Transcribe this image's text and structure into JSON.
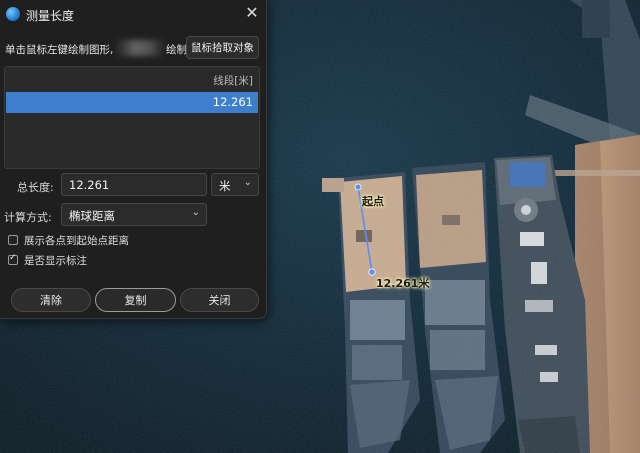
{
  "dialog": {
    "title": "测量长度",
    "instruction": "单击鼠标左键绘制图形,",
    "instruction_tail": "绘制",
    "pick_button": "鼠标拾取对象",
    "list": {
      "header": "线段[米]",
      "rows": [
        "12.261"
      ]
    },
    "total_length": {
      "label": "总长度:",
      "value": "12.261",
      "unit": "米"
    },
    "calc_method": {
      "label": "计算方式:",
      "value": "椭球距离"
    },
    "options": [
      {
        "label": "展示各点到起始点距离",
        "checked": false
      },
      {
        "label": "是否显示标注",
        "checked": true
      }
    ],
    "buttons": {
      "clear": "清除",
      "copy": "复制",
      "close": "关闭"
    }
  },
  "map_overlay": {
    "start_label": "起点",
    "measure_label": "12.261米"
  },
  "colors": {
    "accent": "#3d7fcc",
    "measure_line": "#5b8ff0",
    "dialog_bg": "#1f1f1f"
  },
  "icons": [
    "app-globe-icon",
    "close-icon",
    "chevron-down-icon",
    "checkbox-icon",
    "check-mark-icon"
  ]
}
